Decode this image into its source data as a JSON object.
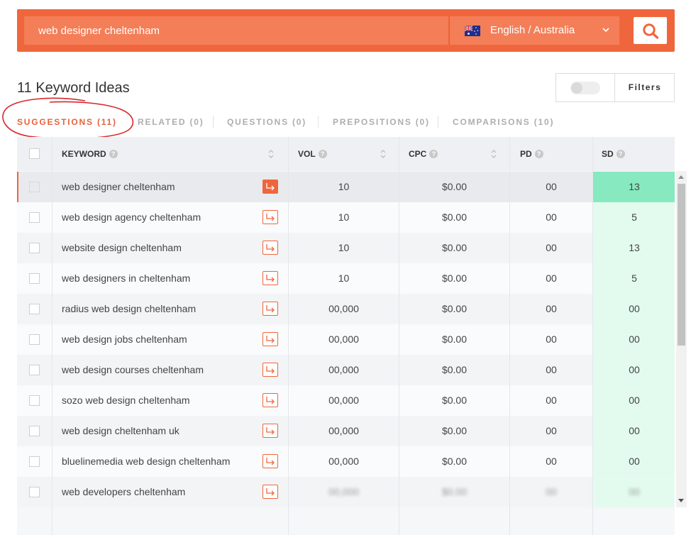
{
  "search": {
    "query": "web designer cheltenham"
  },
  "language": {
    "selected": "English / Australia"
  },
  "header": {
    "title": "11 Keyword Ideas",
    "filters_label": "Filters"
  },
  "tabs": [
    {
      "label": "SUGGESTIONS (11)"
    },
    {
      "label": "RELATED (0)"
    },
    {
      "label": "QUESTIONS (0)"
    },
    {
      "label": "PREPOSITIONS (0)"
    },
    {
      "label": "COMPARISONS (10)"
    }
  ],
  "table": {
    "headers": {
      "keyword": "KEYWORD",
      "vol": "VOL",
      "cpc": "CPC",
      "pd": "PD",
      "sd": "SD"
    },
    "rows": [
      {
        "keyword": "web designer cheltenham",
        "vol": "10",
        "cpc": "$0.00",
        "pd": "00",
        "sd": "13"
      },
      {
        "keyword": "web design agency cheltenham",
        "vol": "10",
        "cpc": "$0.00",
        "pd": "00",
        "sd": "5"
      },
      {
        "keyword": "website design cheltenham",
        "vol": "10",
        "cpc": "$0.00",
        "pd": "00",
        "sd": "13"
      },
      {
        "keyword": "web designers in cheltenham",
        "vol": "10",
        "cpc": "$0.00",
        "pd": "00",
        "sd": "5"
      },
      {
        "keyword": "radius web design cheltenham",
        "vol": "00,000",
        "cpc": "$0.00",
        "pd": "00",
        "sd": "00"
      },
      {
        "keyword": "web design jobs cheltenham",
        "vol": "00,000",
        "cpc": "$0.00",
        "pd": "00",
        "sd": "00"
      },
      {
        "keyword": "web design courses cheltenham",
        "vol": "00,000",
        "cpc": "$0.00",
        "pd": "00",
        "sd": "00"
      },
      {
        "keyword": "sozo web design cheltenham",
        "vol": "00,000",
        "cpc": "$0.00",
        "pd": "00",
        "sd": "00"
      },
      {
        "keyword": "web design cheltenham uk",
        "vol": "00,000",
        "cpc": "$0.00",
        "pd": "00",
        "sd": "00"
      },
      {
        "keyword": "bluelinemedia web design cheltenham",
        "vol": "00,000",
        "cpc": "$0.00",
        "pd": "00",
        "sd": "00"
      },
      {
        "keyword": "web developers cheltenham",
        "vol": "00,000",
        "cpc": "$0.00",
        "pd": "00",
        "sd": "00"
      }
    ]
  },
  "colors": {
    "accent": "#f0663c",
    "sd_highlight": "#86e9c0",
    "sd_cell": "#e2fbee"
  },
  "icons": [
    "australia-flag-icon",
    "chevron-down-icon",
    "search-icon",
    "help-icon",
    "sort-icon",
    "go-arrow-icon"
  ]
}
